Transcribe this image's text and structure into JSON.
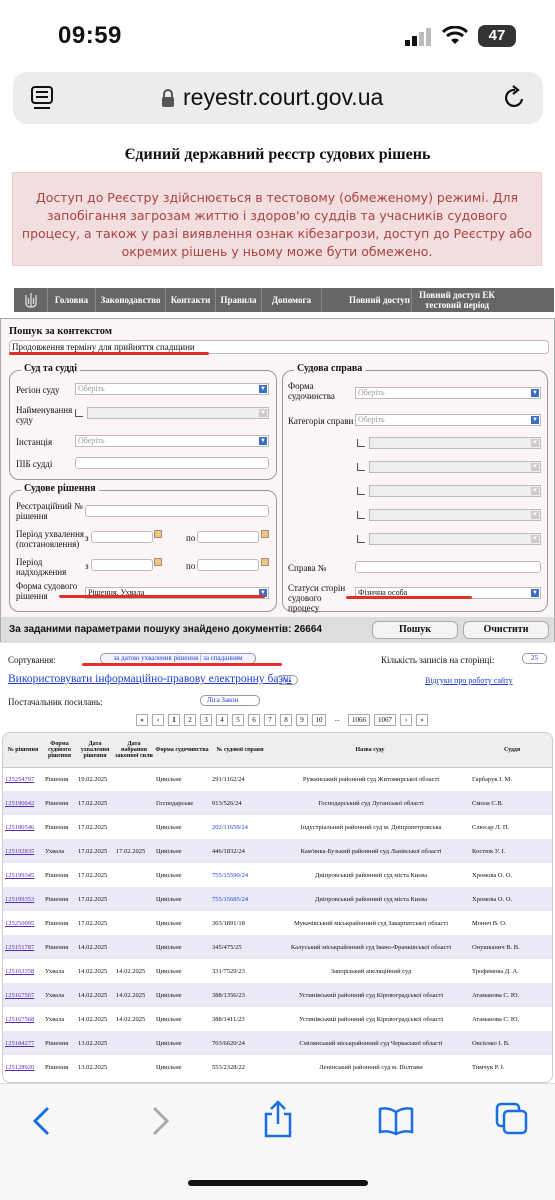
{
  "status": {
    "time": "09:59",
    "battery": "47"
  },
  "browser": {
    "url": "reyestr.court.gov.ua"
  },
  "page": {
    "title": "Єдиний державний реєстр судових рішень",
    "notice": "Доступ до Реєстру здійснюється в тестовому (обмеженому) режимі. Для запобігання загрозам життю і здоров'ю суддів та учасників судового процесу, а також у разі виявлення ознак кібезагрози, доступ до Реєстру або окремих рішень у ньому може бути обмежено."
  },
  "nav": {
    "items": [
      "Головна",
      "Законодавство",
      "Контакти",
      "Правила",
      "Допомога",
      "Повний доступ",
      "Повний доступ ЕК тестовий період"
    ]
  },
  "search": {
    "title": "Пошук за контекстом",
    "query": "Продовження терміну для прийняття спадщини",
    "court_legend": "Суд та судді",
    "region_label": "Регіон суду",
    "name_label": "Найменування суду",
    "instance_label": "Інстанція",
    "judge_label": "ПІБ судді",
    "select_placeholder": "Оберіть",
    "decision_legend": "Судове рішення",
    "regnum_label": "Реєстраційний № рішення",
    "adopt_label": "Період ухвалення (постановлення)",
    "receive_label": "Період надходження",
    "from": "з",
    "to": "по",
    "form_label": "Форма судового рішення",
    "form_value": "Рішення, Ухвала",
    "case_legend": "Судова справа",
    "proc_label": "Форма судочинства",
    "category_label": "Категорія справи",
    "case_label": "Справа №",
    "party_label": "Статуси сторін судового процесу",
    "party_value": "Фізична особа",
    "found_text": "За заданими параметрами пошуку знайдено документів: 26664",
    "search_btn": "Пошук",
    "clear_btn": "Очистити"
  },
  "results": {
    "sort_label": "Сортування:",
    "sort_value": "за датою ухвалення рішення | за спаданням",
    "count_label": "Кількість записів на сторінці:",
    "count_value": "25",
    "use_link": "Використовувати інформаційно-правову електронну базу:",
    "use_value": "так",
    "feedback_link": "Відгуки про роботу сайту",
    "provider_label": "Постачальник посилань:",
    "provider_value": "Ліга Закон",
    "pages": [
      "«",
      "‹",
      "1",
      "2",
      "3",
      "4",
      "5",
      "6",
      "7",
      "8",
      "9",
      "10",
      "...",
      "1066",
      "1067",
      "›",
      "»"
    ],
    "headers": [
      "№ рішення",
      "Форма судового рішення",
      "Дата ухвалення рішення",
      "Дата набрання законної сили",
      "Форма судочинства",
      "№ судової справи",
      "Назва суду",
      "Суддя"
    ],
    "rows": [
      [
        "125254797",
        "Рішення",
        "19.02.2025",
        "",
        "Цивільне",
        "291/1162/24",
        "Ружинський районний суд Житомирської області",
        "Гарбарук І. М."
      ],
      [
        "125190042",
        "Рішення",
        "17.02.2025",
        "",
        "Господарське",
        "913/526/24",
        "Господарський суд Луганської області",
        "Смола С.В."
      ],
      [
        "125180546",
        "Рішення",
        "17.02.2025",
        "",
        "Цивільне",
        "202/11659/24",
        "Індустріальний районний суд м. Дніпропетровська",
        "Слюсар Л. П."
      ],
      [
        "125192835",
        "Ухвала",
        "17.02.2025",
        "17.02.2025",
        "Цивільне",
        "446/1832/24",
        "Кам'янка-Бузький районний суд Львівської області",
        "Костюк У. І."
      ],
      [
        "125199345",
        "Рішення",
        "17.02.2025",
        "",
        "Цивільне",
        "755/15590/24",
        "Дніпровський районний суд міста Києва",
        "Хромова О. О."
      ],
      [
        "125199353",
        "Рішення",
        "17.02.2025",
        "",
        "Цивільне",
        "755/15685/24",
        "Дніпровський районний суд міста Києва",
        "Хромова О. О."
      ],
      [
        "125250095",
        "Рішення",
        "17.02.2025",
        "",
        "Цивільне",
        "303/1891/18",
        "Мукачівський міськрайонний суд Закарпатської області",
        "Монич В. О."
      ],
      [
        "125151787",
        "Рішення",
        "14.02.2025",
        "",
        "Цивільне",
        "345/475/25",
        "Калуський міськрайонний суд Івано-Франківської області",
        "Онушканич В. В."
      ],
      [
        "125163358",
        "Ухвала",
        "14.02.2025",
        "14.02.2025",
        "Цивільне",
        "331/7529/23",
        "Запорізький апеляційний суд",
        "Трофимова Д. А."
      ],
      [
        "125167567",
        "Ухвала",
        "14.02.2025",
        "14.02.2025",
        "Цивільне",
        "388/1356/23",
        "Устинівський районний суд Кіровоградської області",
        "Атаманова С. Ю."
      ],
      [
        "125167568",
        "Ухвала",
        "14.02.2025",
        "14.02.2025",
        "Цивільне",
        "388/1411/23",
        "Устинівський районний суд Кіровоградської області",
        "Атаманова С. Ю."
      ],
      [
        "125184277",
        "Рішення",
        "13.02.2025",
        "",
        "Цивільне",
        "703/6620/24",
        "Смілянський міськрайонний суд Черкаської області",
        "Овсієнко І. В."
      ],
      [
        "125128920",
        "Рішення",
        "13.02.2025",
        "",
        "Цивільне",
        "553/2328/22",
        "Ленінський районний суд м. Полтави",
        "Тимчук Р. І."
      ]
    ]
  }
}
